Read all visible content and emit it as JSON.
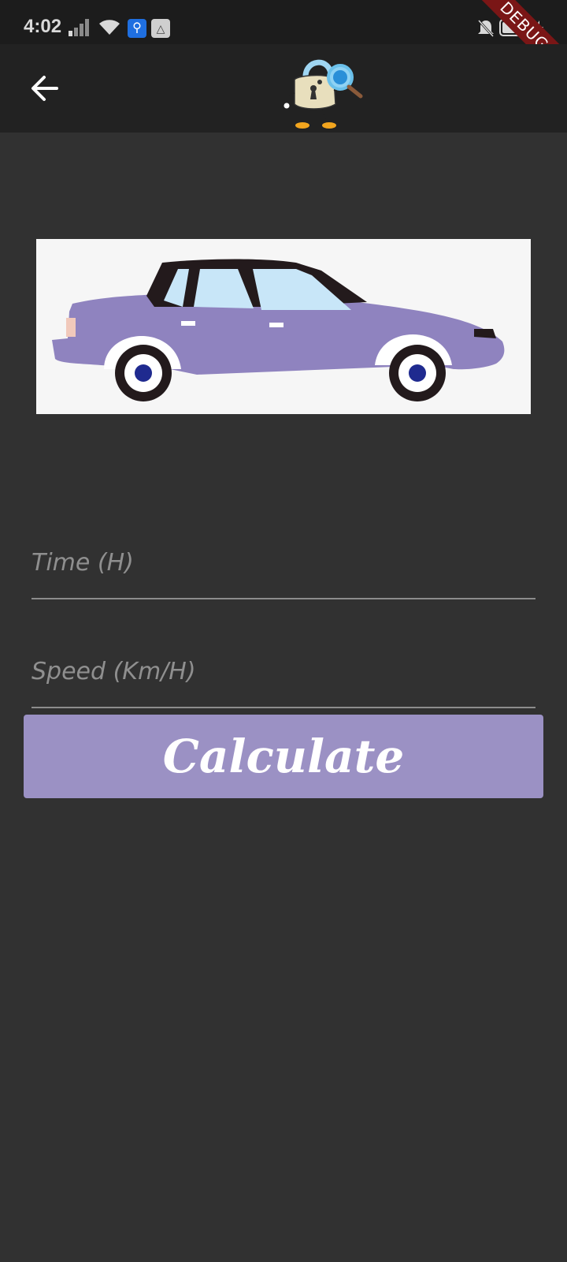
{
  "status_bar": {
    "time": "4:02",
    "icons": [
      "signal-icon",
      "wifi-icon",
      "usb-icon",
      "app-notification-icon",
      "silent-icon",
      "battery-icon",
      "charging-icon"
    ]
  },
  "debug_banner": "DEBUG",
  "app_bar": {
    "back_icon": "arrow-back-icon",
    "logo": "detective-lock-logo"
  },
  "hero": {
    "image": "purple-car-illustration"
  },
  "form": {
    "time_placeholder": "Time (H)",
    "speed_placeholder": "Speed (Km/H)",
    "time_value": "",
    "speed_value": ""
  },
  "actions": {
    "calculate_label": "Calculate"
  },
  "colors": {
    "background": "#313131",
    "app_bar": "#222222",
    "status_bar": "#1c1c1c",
    "button": "#9b91c4",
    "car_body": "#8f83bf"
  }
}
